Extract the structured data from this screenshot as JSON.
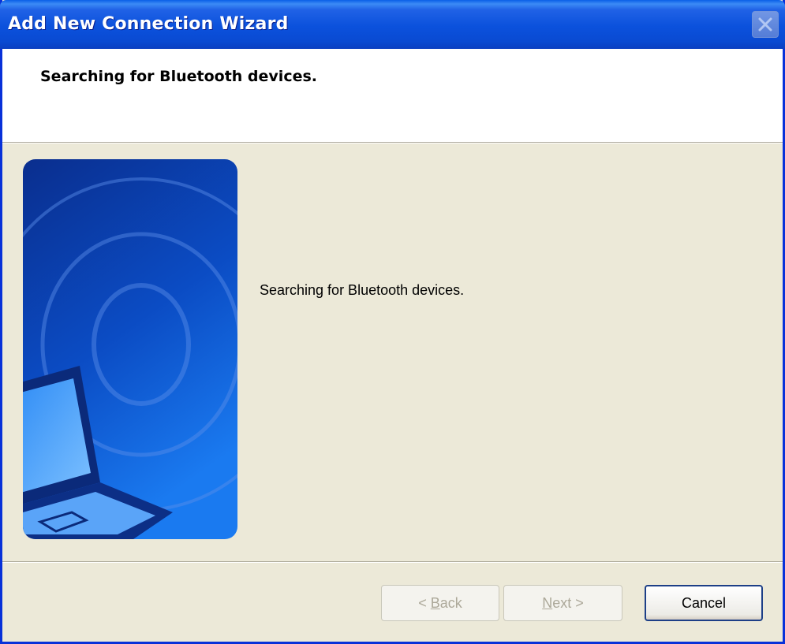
{
  "window": {
    "title": "Add New Connection Wizard"
  },
  "header": {
    "title": "Searching for Bluetooth devices."
  },
  "content": {
    "message": "Searching for Bluetooth devices."
  },
  "buttons": {
    "back": {
      "arrow": "<",
      "mnemonic": "B",
      "rest": "ack",
      "enabled": false
    },
    "next": {
      "mnemonic": "N",
      "rest": "ext",
      "arrow": ">",
      "enabled": false
    },
    "cancel": {
      "label": "Cancel",
      "enabled": true
    }
  },
  "icons": {
    "close": "close-icon",
    "banner": "laptop-wireless-illustration"
  },
  "colors": {
    "titlebar": "#0B51DC",
    "dialog_bg": "#ECE9D8",
    "banner": "#0B50C8",
    "default_button_border": "#1D3F87"
  }
}
